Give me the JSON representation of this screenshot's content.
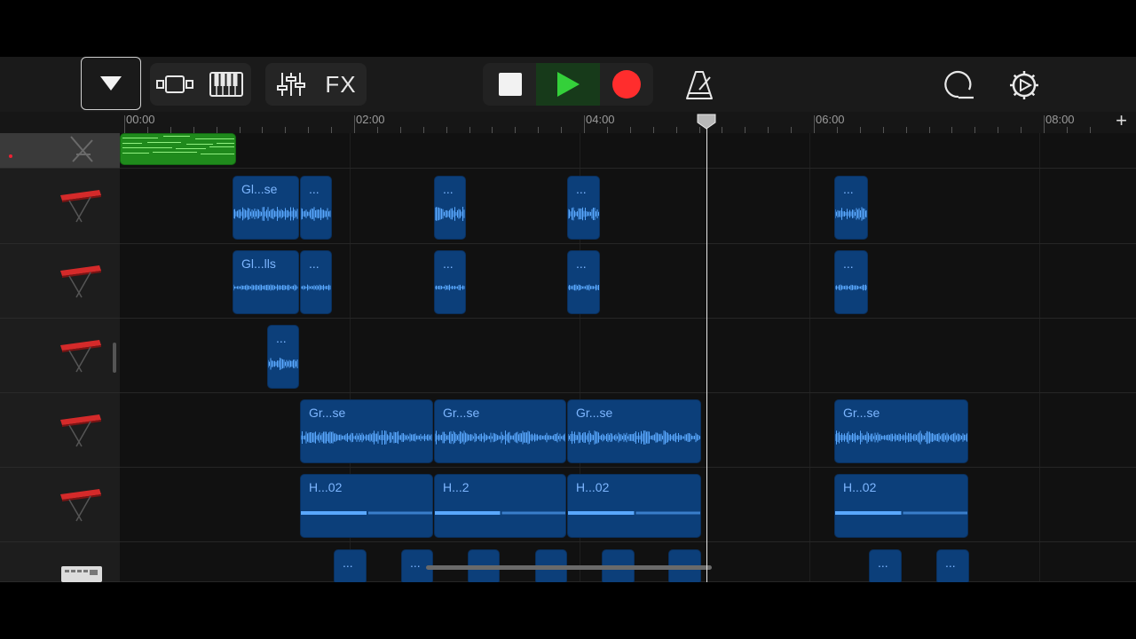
{
  "toolbar": {
    "fx_label": "FX"
  },
  "ruler": {
    "labels": [
      "00:00",
      "02:00",
      "04:00",
      "06:00",
      "08:00"
    ],
    "add_track": "+"
  },
  "tracks": [
    {
      "instrument": "drum-kit",
      "selected": true
    },
    {
      "instrument": "keyboard"
    },
    {
      "instrument": "keyboard"
    },
    {
      "instrument": "keyboard"
    },
    {
      "instrument": "keyboard"
    },
    {
      "instrument": "keyboard"
    },
    {
      "instrument": "beat-machine"
    }
  ],
  "regions": {
    "track2": [
      "Gl...se",
      "...",
      "...",
      "...",
      "..."
    ],
    "track3": [
      "Gl...lls",
      "...",
      "...",
      "...",
      "..."
    ],
    "track4": [
      "..."
    ],
    "track5": [
      "Gr...se",
      "Gr...se",
      "Gr...se",
      "Gr...se"
    ],
    "track6": [
      "H...02",
      "H...2",
      "H...02",
      "H...02"
    ],
    "track7": [
      "...",
      "...",
      "...",
      "...",
      "...",
      "...",
      "...",
      "..."
    ]
  },
  "colors": {
    "audio_region": "#0c3f7a",
    "region_text": "#7db6ff",
    "waveform": "#5aa8ff",
    "midi_region": "#1f8a1c",
    "play": "#34d03a",
    "record": "#ff2d2d"
  }
}
